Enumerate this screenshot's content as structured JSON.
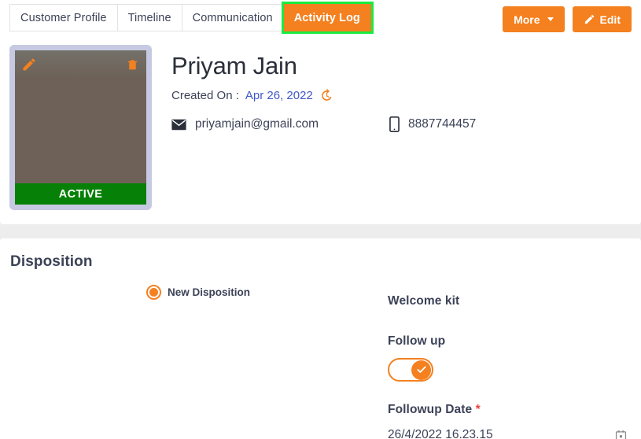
{
  "tabs": [
    {
      "label": "Customer Profile",
      "active": false
    },
    {
      "label": "Timeline",
      "active": false
    },
    {
      "label": "Communication",
      "active": false
    },
    {
      "label": "Activity Log",
      "active": true
    }
  ],
  "header_actions": {
    "more_label": "More",
    "edit_label": "Edit"
  },
  "profile": {
    "name": "Priyam Jain",
    "created_on_label": "Created On :",
    "created_on_value": "Apr 26, 2022",
    "status_badge": "ACTIVE",
    "email": "priyamjain@gmail.com",
    "phone": "8887744457",
    "photo_edit_icon": "pencil-icon",
    "photo_delete_icon": "trash-icon",
    "history_icon": "history-icon",
    "email_icon": "envelope-icon",
    "phone_icon": "mobile-phone-icon"
  },
  "disposition": {
    "title": "Disposition",
    "radio_label": "New Disposition",
    "radio_selected": true,
    "welcome_kit_label": "Welcome kit",
    "follow_up_label": "Follow up",
    "follow_up_on": true,
    "followup_date_label": "Followup Date",
    "required_marker": "*",
    "followup_date_value": "26/4/2022 16.23.15",
    "calendar_icon": "calendar-icon"
  },
  "colors": {
    "accent": "#f4801f",
    "highlight": "#1aeb41",
    "active_green": "#068006",
    "link_blue": "#3f58c4",
    "required_red": "#e8453c",
    "text_dark": "#3c4257",
    "card_frame": "#c7c9e2",
    "page_bg": "#ededed"
  }
}
